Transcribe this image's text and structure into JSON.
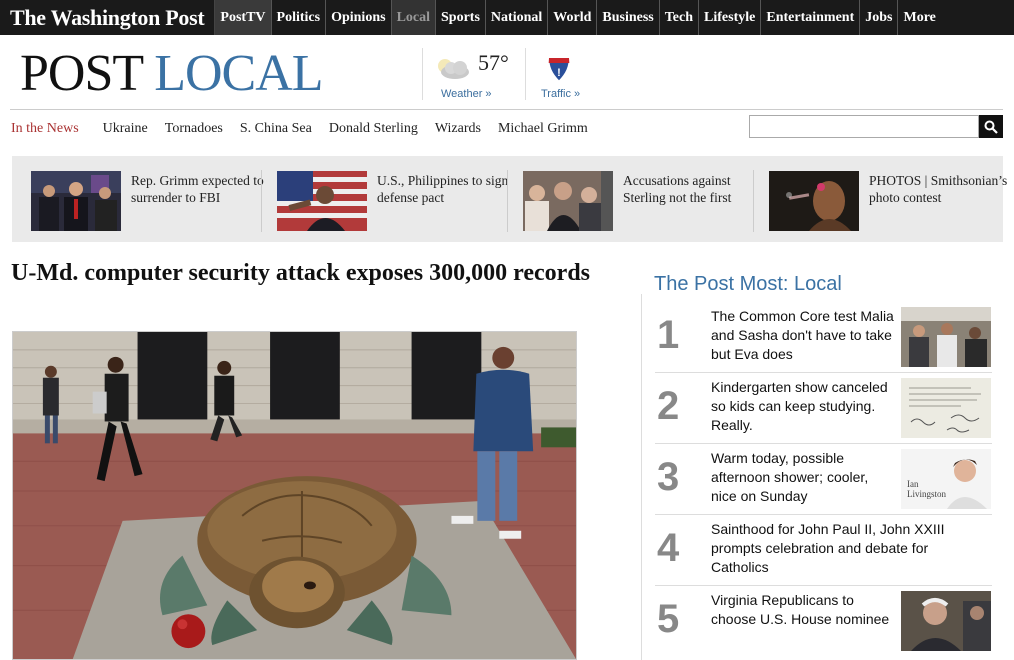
{
  "nav": {
    "logo": "The Washington Post",
    "items": [
      "PostTV",
      "Politics",
      "Opinions",
      "Local",
      "Sports",
      "National",
      "World",
      "Business",
      "Tech",
      "Lifestyle",
      "Entertainment",
      "Jobs",
      "More"
    ],
    "active": "Local"
  },
  "masthead": {
    "post": "POST",
    "local": "LOCAL"
  },
  "weather": {
    "temp": "57°",
    "label": "Weather »",
    "icon": "cloud-icon"
  },
  "traffic": {
    "label": "Traffic »",
    "icon": "interstate-sign-icon"
  },
  "in_the_news": {
    "label": "In the News",
    "items": [
      "Ukraine",
      "Tornadoes",
      "S. China Sea",
      "Donald Sterling",
      "Wizards",
      "Michael Grimm"
    ]
  },
  "search": {
    "placeholder": "",
    "icon": "search-icon"
  },
  "promos": [
    {
      "text": "Rep. Grimm expected to surrender to FBI"
    },
    {
      "text": "U.S., Philippines to sign defense pact"
    },
    {
      "text": "Accusations against Sterling not the first"
    },
    {
      "text": "PHOTOS | Smithsonian’s photo contest"
    }
  ],
  "article": {
    "headline": "U-Md. computer security attack exposes 300,000 records"
  },
  "most_popular": {
    "title": "The Post Most: Local",
    "items": [
      {
        "rank": "1",
        "title": "The Common Core test Malia and Sasha don't have to take but Eva does"
      },
      {
        "rank": "2",
        "title": "Kindergarten show canceled so kids can keep studying. Really."
      },
      {
        "rank": "3",
        "title": "Warm today, possible afternoon shower; cooler, nice on Sunday",
        "thumb_caption": "Ian Livingston"
      },
      {
        "rank": "4",
        "title": "Sainthood for John Paul II, John XXIII prompts celebration and debate for Catholics"
      },
      {
        "rank": "5",
        "title": "Virginia Republicans to choose U.S. House nominee"
      }
    ]
  },
  "colors": {
    "nav_bg": "#1a1a1a",
    "brand_blue": "#3b72a4",
    "news_label": "#a33333",
    "promo_bg": "#eaeaea"
  }
}
